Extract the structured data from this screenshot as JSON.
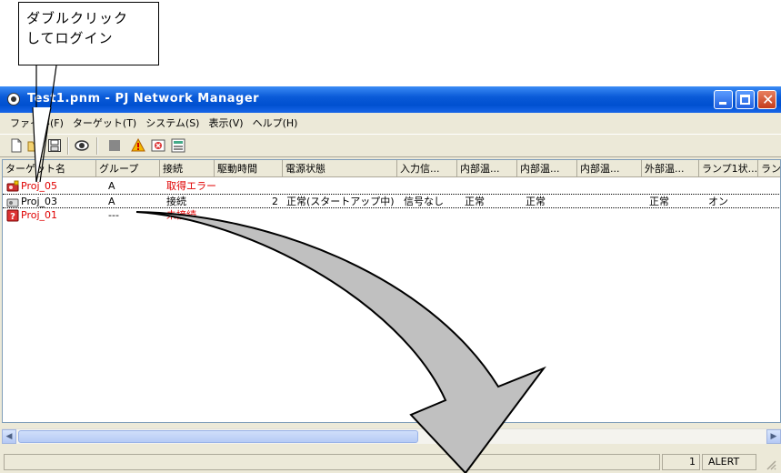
{
  "callout": {
    "line1": "ダブルクリック",
    "line2": "してログイン"
  },
  "window": {
    "title": "Test1.pnm - PJ Network Manager"
  },
  "menu": [
    "ファイル(F)",
    "ターゲット(T)",
    "システム(S)",
    "表示(V)",
    "ヘルプ(H)"
  ],
  "toolbar_icons": [
    "new-file-icon",
    "open-folder-icon",
    "save-icon",
    "view-icon",
    "stop-icon",
    "warning-icon",
    "error-icon",
    "settings-icon"
  ],
  "columns": [
    "ターゲット名",
    "グループ",
    "接続",
    "駆動時間",
    "電源状態",
    "入力信...",
    "内部温...",
    "内部温...",
    "内部温...",
    "外部温...",
    "ランプ1状...",
    "ラン"
  ],
  "rows": [
    {
      "name": "Proj_05",
      "group": "A",
      "conn": "取得エラー",
      "hours": "",
      "power": "",
      "input": "",
      "t1": "",
      "t2": "",
      "t3": "",
      "ext": "",
      "lamp": "",
      "status": "error"
    },
    {
      "name": "Proj_03",
      "group": "A",
      "conn": "接続",
      "hours": "2",
      "power": "正常(スタートアップ中)",
      "input": "信号なし",
      "t1": "正常",
      "t2": "正常",
      "t3": "",
      "ext": "正常",
      "lamp": "オン",
      "status": "normal"
    },
    {
      "name": "Proj_01",
      "group": "---",
      "conn": "未接続",
      "hours": "",
      "power": "",
      "input": "",
      "t1": "",
      "t2": "",
      "t3": "",
      "ext": "",
      "lamp": "",
      "status": "disconnected"
    }
  ],
  "statusbar": {
    "count": "1",
    "alert": "ALERT"
  },
  "colors": {
    "error_text": "#e00000",
    "titlebar": "#0a5ad8",
    "window_bg": "#ece9d8"
  }
}
